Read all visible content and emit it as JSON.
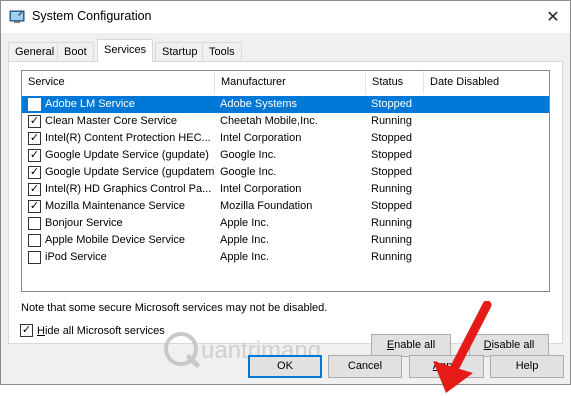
{
  "window": {
    "title": "System Configuration",
    "close_glyph": "✕"
  },
  "tabs": [
    {
      "label": "General"
    },
    {
      "label": "Boot"
    },
    {
      "label": "Services"
    },
    {
      "label": "Startup"
    },
    {
      "label": "Tools"
    }
  ],
  "active_tab": "Services",
  "columns": {
    "service": "Service",
    "manufacturer": "Manufacturer",
    "status": "Status",
    "date_disabled": "Date Disabled"
  },
  "services": [
    {
      "name": "Adobe LM Service",
      "manufacturer": "Adobe Systems",
      "status": "Stopped",
      "checked": false,
      "selected": true
    },
    {
      "name": "Clean Master Core Service",
      "manufacturer": "Cheetah Mobile,Inc.",
      "status": "Running",
      "checked": true,
      "selected": false
    },
    {
      "name": "Intel(R) Content Protection HEC...",
      "manufacturer": "Intel Corporation",
      "status": "Stopped",
      "checked": true,
      "selected": false
    },
    {
      "name": "Google Update Service (gupdate)",
      "manufacturer": "Google Inc.",
      "status": "Stopped",
      "checked": true,
      "selected": false
    },
    {
      "name": "Google Update Service (gupdatem)",
      "manufacturer": "Google Inc.",
      "status": "Stopped",
      "checked": true,
      "selected": false
    },
    {
      "name": "Intel(R) HD Graphics Control Pa...",
      "manufacturer": "Intel Corporation",
      "status": "Running",
      "checked": true,
      "selected": false
    },
    {
      "name": "Mozilla Maintenance Service",
      "manufacturer": "Mozilla Foundation",
      "status": "Stopped",
      "checked": true,
      "selected": false
    },
    {
      "name": "Bonjour Service",
      "manufacturer": "Apple Inc.",
      "status": "Running",
      "checked": false,
      "selected": false
    },
    {
      "name": "Apple Mobile Device Service",
      "manufacturer": "Apple Inc.",
      "status": "Running",
      "checked": false,
      "selected": false
    },
    {
      "name": "iPod Service",
      "manufacturer": "Apple Inc.",
      "status": "Running",
      "checked": false,
      "selected": false
    }
  ],
  "note": "Note that some secure Microsoft services may not be disabled.",
  "enable_all": {
    "accel": "E",
    "rest": "nable all"
  },
  "disable_all": {
    "accel": "D",
    "rest": "isable all"
  },
  "hide_ms": {
    "accel": "H",
    "rest": "ide all Microsoft services",
    "checked": true
  },
  "buttons": {
    "ok": "OK",
    "cancel": "Cancel",
    "apply_accel": "A",
    "apply_rest": "pply",
    "help": "Help"
  },
  "watermark": {
    "text": "uantrimang"
  },
  "colors": {
    "selection": "#0078d7",
    "arrow": "#e41b17",
    "dialog_bg": "#f0f0f0"
  },
  "icons": {
    "app": "system-configuration-icon",
    "close": "close-icon",
    "check": "✓"
  }
}
